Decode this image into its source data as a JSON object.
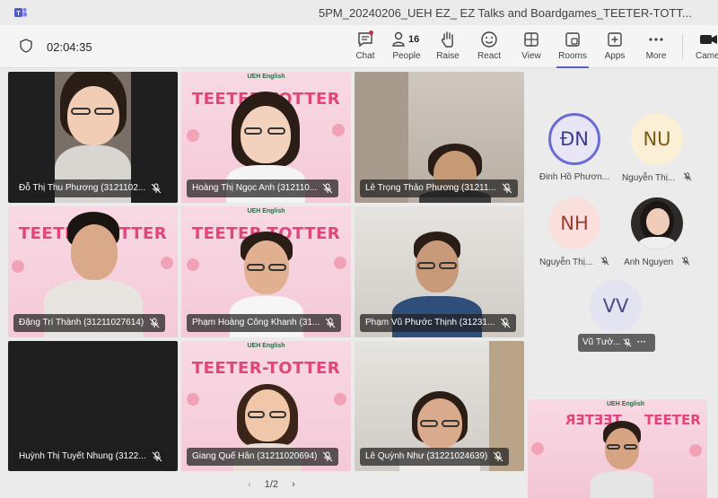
{
  "window": {
    "title": "5PM_20240206_UEH EZ_ EZ Talks and Boardgames_TEETER-TOTT..."
  },
  "toolbar": {
    "timer": "02:04:35",
    "people_count": "16",
    "buttons": [
      {
        "label": "Chat",
        "icon": "chat-icon"
      },
      {
        "label": "People",
        "icon": "people-icon"
      },
      {
        "label": "Raise",
        "icon": "raise-hand-icon"
      },
      {
        "label": "React",
        "icon": "react-icon"
      },
      {
        "label": "View",
        "icon": "view-icon"
      },
      {
        "label": "Rooms",
        "icon": "rooms-icon"
      },
      {
        "label": "Apps",
        "icon": "apps-icon"
      },
      {
        "label": "More",
        "icon": "more-icon"
      },
      {
        "label": "Came",
        "icon": "camera-icon"
      }
    ]
  },
  "brand": {
    "banner": "TEETER-TOTTER",
    "banner_partial": "TEETER-TOTTER",
    "mirrored_banner": "TEETER",
    "mirrored_banner2": "TEETER",
    "logo": "UEH English"
  },
  "tiles": [
    {
      "name": "Đỗ Thị Thu Phương (3121102..."
    },
    {
      "name": "Hoàng Thị Ngọc Anh (312110..."
    },
    {
      "name": "Lê Trọng Thảo Phương (31211..."
    },
    {
      "name": "Đặng Trí Thành (31211027614)"
    },
    {
      "name": "Phạm Hoàng Công Khanh (31..."
    },
    {
      "name": "Phạm Vũ Phước Thịnh (31231..."
    },
    {
      "name": "Huỳnh Thị Tuyết Nhung (3122..."
    },
    {
      "name": "Giang Quế Hân (31211020694)"
    },
    {
      "name": "Lê Quỳnh Như (31221024639)"
    }
  ],
  "pager": {
    "prev": "‹",
    "label": "1/2",
    "next": "›"
  },
  "sidebar": {
    "participants": [
      {
        "initials": "ĐN",
        "name": "Đinh Hồ Phươn..."
      },
      {
        "initials": "NU",
        "name": "Nguyễn Thị..."
      },
      {
        "initials": "NH",
        "name": "Nguyễn Thị..."
      },
      {
        "initials": "",
        "name": "Anh Nguyen"
      },
      {
        "initials": "VV",
        "name": "Vũ Tườ..."
      }
    ],
    "more_label": "···"
  },
  "colors": {
    "accent": "#5b5fc7",
    "banner_pink": "#e2457b",
    "notification": "#c4314b"
  }
}
